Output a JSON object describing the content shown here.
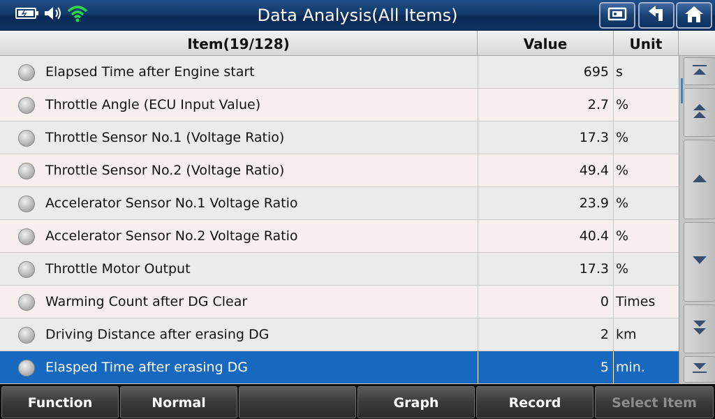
{
  "header": {
    "title": "Data Analysis(All Items)",
    "icons": [
      "battery-icon",
      "speaker-icon",
      "wifi-icon"
    ],
    "buttons": [
      "print-icon",
      "back-up-icon",
      "home-icon"
    ]
  },
  "table": {
    "columns": {
      "item": "Item(19/128)",
      "value": "Value",
      "unit": "Unit"
    },
    "rows": [
      {
        "name": "Elapsed Time after Engine start",
        "value": "695",
        "unit": "s"
      },
      {
        "name": "Throttle Angle (ECU Input Value)",
        "value": "2.7",
        "unit": "%"
      },
      {
        "name": "Throttle Sensor No.1 (Voltage Ratio)",
        "value": "17.3",
        "unit": "%"
      },
      {
        "name": "Throttle Sensor No.2 (Voltage Ratio)",
        "value": "49.4",
        "unit": "%"
      },
      {
        "name": "Accelerator Sensor No.1 Voltage Ratio",
        "value": "23.9",
        "unit": "%"
      },
      {
        "name": "Accelerator Sensor No.2 Voltage Ratio",
        "value": "40.4",
        "unit": "%"
      },
      {
        "name": "Throttle Motor Output",
        "value": "17.3",
        "unit": "%"
      },
      {
        "name": "Warming Count after DG Clear",
        "value": "0",
        "unit": "Times"
      },
      {
        "name": "Driving Distance after erasing DG",
        "value": "2",
        "unit": "km"
      },
      {
        "name": "Elasped Time after erasing DG",
        "value": "5",
        "unit": "min."
      }
    ],
    "selected_index": 9
  },
  "footer": {
    "function": "Function",
    "normal": "Normal",
    "blank": "",
    "graph": "Graph",
    "record": "Record",
    "select_item": "Select Item"
  },
  "colors": {
    "title_bar": "#123a6b",
    "selected_row": "#1769c0",
    "row_a": "#ebebeb",
    "row_b": "#f7eeee"
  }
}
